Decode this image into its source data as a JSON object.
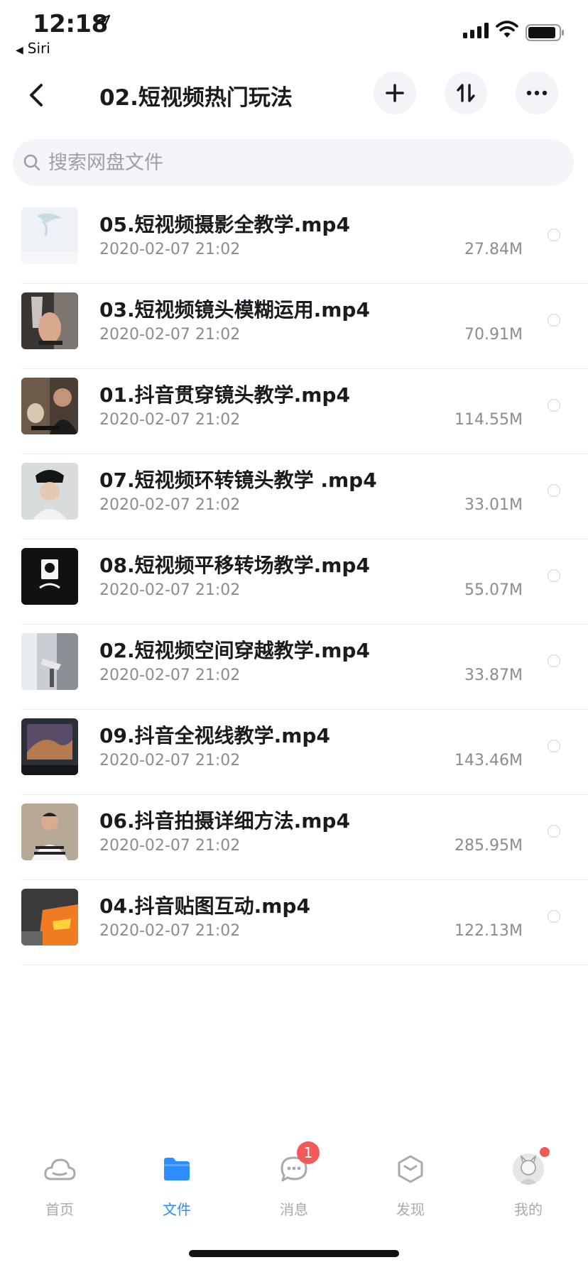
{
  "status_bar": {
    "time": "12:18",
    "back_app": "Siri"
  },
  "header": {
    "title": "02.短视频热门玩法",
    "icons": {
      "back": "chevron-left-icon",
      "add": "plus-icon",
      "sort": "sort-icon",
      "more": "more-icon"
    }
  },
  "search": {
    "placeholder": "搜索网盘文件"
  },
  "files": [
    {
      "name": "05.短视频摄影全教学.mp4",
      "date": "2020-02-07 21:02",
      "size": "27.84M"
    },
    {
      "name": "03.短视频镜头模糊运用.mp4",
      "date": "2020-02-07 21:02",
      "size": "70.91M"
    },
    {
      "name": "01.抖音贯穿镜头教学.mp4",
      "date": "2020-02-07 21:02",
      "size": "114.55M"
    },
    {
      "name": "07.短视频环转镜头教学 .mp4",
      "date": "2020-02-07 21:02",
      "size": "33.01M"
    },
    {
      "name": "08.短视频平移转场教学.mp4",
      "date": "2020-02-07 21:02",
      "size": "55.07M"
    },
    {
      "name": "02.短视频空间穿越教学.mp4",
      "date": "2020-02-07 21:02",
      "size": "33.87M"
    },
    {
      "name": "09.抖音全视线教学.mp4",
      "date": "2020-02-07 21:02",
      "size": "143.46M"
    },
    {
      "name": "06.抖音拍摄详细方法.mp4",
      "date": "2020-02-07 21:02",
      "size": "285.95M"
    },
    {
      "name": "04.抖音贴图互动.mp4",
      "date": "2020-02-07 21:02",
      "size": "122.13M"
    }
  ],
  "tabs": [
    {
      "label": "首页",
      "icon": "cloud-icon"
    },
    {
      "label": "文件",
      "icon": "folder-icon",
      "active": true
    },
    {
      "label": "消息",
      "icon": "chat-icon",
      "badge": "1"
    },
    {
      "label": "发现",
      "icon": "discover-icon"
    },
    {
      "label": "我的",
      "icon": "avatar"
    }
  ],
  "colors": {
    "accent": "#2d8cff",
    "badge": "#f25a5a",
    "text": "#1b1b1f",
    "muted": "#888c94"
  }
}
